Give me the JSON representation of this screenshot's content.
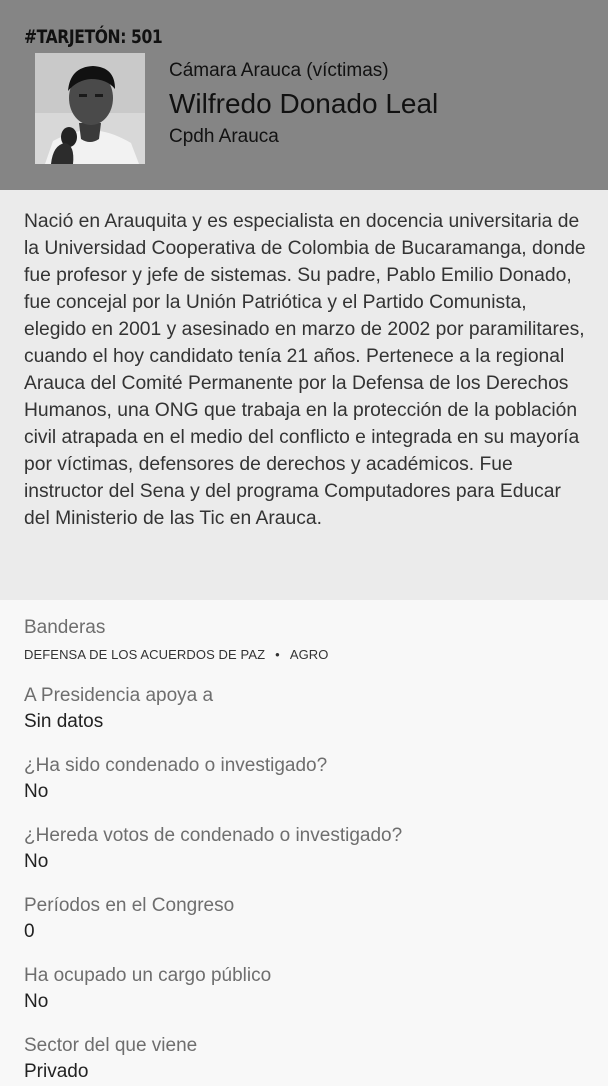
{
  "header": {
    "tarjeton": "#TARJETÓN: 501",
    "camara": "Cámara Arauca (víctimas)",
    "name": "Wilfredo Donado Leal",
    "party": "Cpdh Arauca"
  },
  "bio": "Nació en Arauquita y es especialista en docencia universitaria de la Universidad Cooperativa de Colombia de Bucaramanga, donde fue profesor y jefe de sistemas. Su padre, Pablo Emilio Donado, fue concejal por la Unión Patriótica y el Partido Comunista, elegido en 2001 y asesinado en marzo de 2002 por paramilitares, cuando el hoy candidato tenía 21 años. Pertenece a la regional Arauca del Comité Permanente por la Defensa de los Derechos Humanos, una ONG que trabaja en la protección de la población civil atrapada en el medio del conflicto e integrada en su mayoría por víctimas, defensores de derechos y académicos. Fue instructor del Sena y del programa Computadores para Educar del Ministerio de las Tic en Arauca.",
  "banderas": {
    "label": "Banderas",
    "items": [
      "DEFENSA DE LOS ACUERDOS DE PAZ",
      "AGRO"
    ],
    "separator": "•"
  },
  "fields": [
    {
      "label": "A Presidencia apoya a",
      "value": "Sin datos"
    },
    {
      "label": "¿Ha sido condenado o investigado?",
      "value": "No"
    },
    {
      "label": "¿Hereda votos de condenado o investigado?",
      "value": "No"
    },
    {
      "label": "Períodos en el Congreso",
      "value": "0"
    },
    {
      "label": "Ha ocupado un cargo público",
      "value": "No"
    },
    {
      "label": "Sector del que viene",
      "value": "Privado"
    }
  ],
  "colors": {
    "header_bg": "#858585",
    "bio_bg": "#ebebeb",
    "page_bg": "#f8f8f8"
  }
}
